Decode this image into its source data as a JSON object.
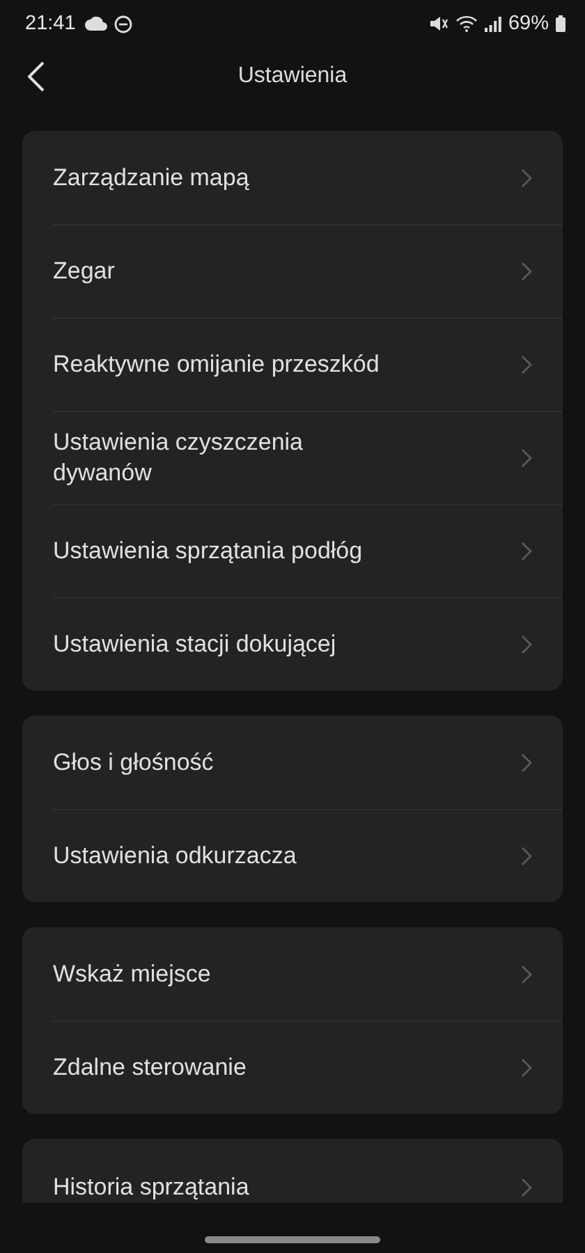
{
  "status_bar": {
    "time": "21:41",
    "battery": "69%"
  },
  "header": {
    "title": "Ustawienia"
  },
  "groups": [
    {
      "items": [
        {
          "label": "Zarządzanie mapą"
        },
        {
          "label": "Zegar"
        },
        {
          "label": "Reaktywne omijanie przeszkód"
        },
        {
          "label": "Ustawienia czyszczenia dywanów"
        },
        {
          "label": "Ustawienia sprzątania podłóg"
        },
        {
          "label": "Ustawienia stacji dokującej"
        }
      ]
    },
    {
      "items": [
        {
          "label": "Głos i głośność"
        },
        {
          "label": "Ustawienia odkurzacza"
        }
      ]
    },
    {
      "items": [
        {
          "label": "Wskaż miejsce"
        },
        {
          "label": "Zdalne sterowanie"
        }
      ]
    },
    {
      "items": [
        {
          "label": "Historia sprzątania"
        }
      ]
    }
  ]
}
